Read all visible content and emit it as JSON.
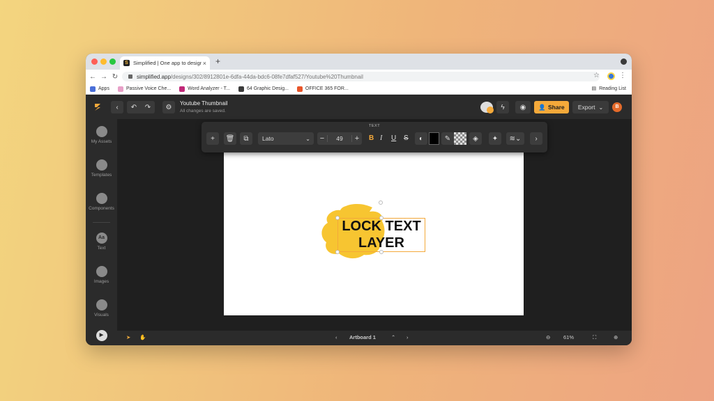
{
  "browser": {
    "tab_title": "Simplified | One app to design,",
    "tab_close": "×",
    "new_tab": "+",
    "url_host": "simplified.app",
    "url_path": "/designs/302/8912801e-6dfa-44da-bdc6-08fe7dfaf527/Youtube%20Thumbnail",
    "bookmarks": [
      {
        "label": "Apps",
        "color": "#4a6fd8"
      },
      {
        "label": "Passive Voice Che...",
        "color": "#e8a0c8"
      },
      {
        "label": "Word Analyzer - T...",
        "color": "#c02878"
      },
      {
        "label": "64 Graphic Desig...",
        "color": "#3a3a3a"
      },
      {
        "label": "OFFICE 365 FOR...",
        "color": "#e8552a"
      }
    ],
    "reading_list": "Reading List"
  },
  "app": {
    "document_title": "Youtube Thumbnail",
    "document_status": "All changes are saved.",
    "share_label": "Share",
    "export_label": "Export",
    "user_initial": "B",
    "accent_color": "#f4a93a"
  },
  "sidebar": {
    "items": [
      {
        "label": "My Assets",
        "icon": "folder-icon"
      },
      {
        "label": "Templates",
        "icon": "templates-icon"
      },
      {
        "label": "Components",
        "icon": "components-icon"
      },
      {
        "label": "Text",
        "icon": "text-icon",
        "glyph": "Aa"
      },
      {
        "label": "Images",
        "icon": "images-icon"
      },
      {
        "label": "Visuals",
        "icon": "visuals-icon"
      }
    ]
  },
  "toolbar": {
    "section_label": "TEXT",
    "font_family": "Lato",
    "font_size": "49",
    "bold": "B",
    "italic": "I",
    "underline": "U",
    "strike": "S"
  },
  "canvas": {
    "text_line_1": "LOCK TEXT",
    "text_line_2": "LAYER",
    "brush_color": "#f7c531"
  },
  "bottom": {
    "artboard_name": "Artboard 1",
    "zoom": "61%"
  }
}
